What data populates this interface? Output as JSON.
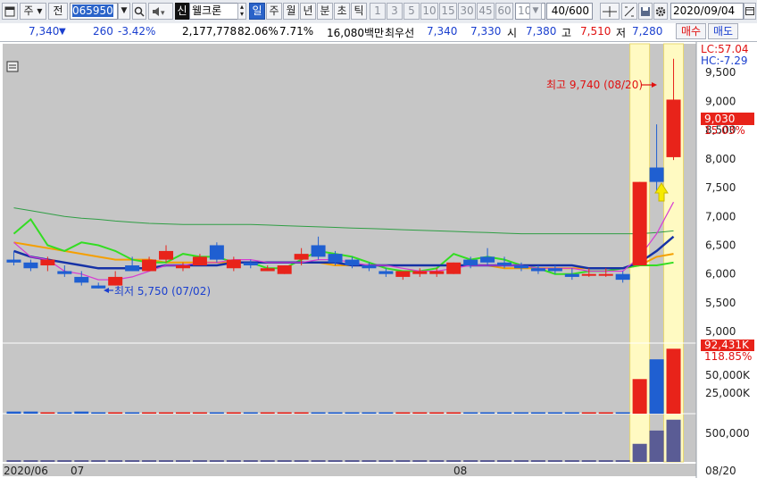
{
  "toolbar": {
    "type_label": "주",
    "prev_label": "전",
    "code": "065950",
    "new_badge": "신",
    "stock_name": "웰크론",
    "periods": [
      "일",
      "주",
      "월",
      "년",
      "분",
      "초",
      "틱"
    ],
    "intervals": [
      "1",
      "3",
      "5",
      "10",
      "15",
      "30",
      "45",
      "60"
    ],
    "interval_value": "10",
    "count": "40/600",
    "date": "2020/09/04"
  },
  "quote": {
    "price": "7,340",
    "change": "260",
    "change_pct": "-3.42%",
    "volume": "2,177,778",
    "vol_ratio": "82.06%",
    "turnover": "7.71%",
    "amount": "16,080백만",
    "best_label": "최우선",
    "ask": "7,340",
    "bid": "7,330",
    "open_label": "시",
    "open": "7,380",
    "high_label": "고",
    "high": "7,510",
    "low_label": "저",
    "low": "7,280",
    "buy_label": "매수",
    "sell_label": "매도"
  },
  "labels": {
    "lc": "LC:57.04",
    "hc": "HC:-7.29",
    "high_note": "최고 9,740 (08/20)",
    "low_note": "최저 5,750 (07/02)",
    "price_tag": "9,030",
    "price_pct": "15.03%",
    "vol_tag": "92,431K",
    "vol_pct": "118.85%",
    "vol_ticks": [
      "50,000K",
      "25,000K"
    ],
    "amt_tick": "500,000",
    "x_labels": [
      "2020/06",
      "07",
      "08"
    ],
    "x_right": "08/20"
  },
  "colors": {
    "up": "#e8231a",
    "down": "#1f5fd1",
    "highlight": "#fffac2"
  },
  "chart_data": {
    "type": "candlestick",
    "ylim": [
      4800,
      10000
    ],
    "yticks": [
      5000,
      5500,
      6000,
      6500,
      7000,
      7500,
      8000,
      8500,
      9000,
      9500
    ],
    "candles": [
      [
        6250,
        6400,
        6150,
        6200
      ],
      [
        6200,
        6250,
        6050,
        6100
      ],
      [
        6150,
        6300,
        6050,
        6250
      ],
      [
        6050,
        6150,
        5950,
        6000
      ],
      [
        5950,
        6050,
        5800,
        5850
      ],
      [
        5800,
        5850,
        5750,
        5750
      ],
      [
        5800,
        6050,
        5800,
        5950
      ],
      [
        6150,
        6300,
        6050,
        6050
      ],
      [
        6050,
        6300,
        6050,
        6250
      ],
      [
        6250,
        6500,
        6200,
        6400
      ],
      [
        6100,
        6200,
        6050,
        6150
      ],
      [
        6150,
        6350,
        6150,
        6300
      ],
      [
        6500,
        6550,
        6200,
        6250
      ],
      [
        6100,
        6300,
        6050,
        6250
      ],
      [
        6200,
        6250,
        6100,
        6150
      ],
      [
        6050,
        6150,
        6050,
        6100
      ],
      [
        6000,
        6150,
        6000,
        6150
      ],
      [
        6250,
        6450,
        6150,
        6350
      ],
      [
        6500,
        6650,
        6250,
        6300
      ],
      [
        6350,
        6400,
        6150,
        6200
      ],
      [
        6250,
        6300,
        6100,
        6150
      ],
      [
        6150,
        6200,
        6050,
        6100
      ],
      [
        6050,
        6100,
        5950,
        6000
      ],
      [
        5950,
        6050,
        5900,
        6050
      ],
      [
        6000,
        6100,
        5950,
        6050
      ],
      [
        6000,
        6100,
        5950,
        6050
      ],
      [
        6000,
        6200,
        6000,
        6200
      ],
      [
        6250,
        6300,
        6100,
        6150
      ],
      [
        6300,
        6450,
        6150,
        6200
      ],
      [
        6200,
        6300,
        6100,
        6150
      ],
      [
        6150,
        6200,
        6050,
        6100
      ],
      [
        6100,
        6150,
        6000,
        6050
      ],
      [
        6100,
        6150,
        6000,
        6050
      ],
      [
        6000,
        6100,
        5900,
        5950
      ],
      [
        6000,
        6100,
        5950,
        6000
      ],
      [
        6000,
        6100,
        5950,
        6000
      ],
      [
        6000,
        6050,
        5850,
        5900
      ],
      [
        6150,
        7600,
        6150,
        7600
      ],
      [
        7850,
        8600,
        7450,
        7600
      ],
      [
        8030,
        9740,
        7980,
        9030
      ]
    ],
    "ma5": [
      6550,
      6300,
      6250,
      6050,
      6000,
      5900,
      5900,
      5950,
      6050,
      6150,
      6150,
      6200,
      6200,
      6250,
      6250,
      6200,
      6200,
      6200,
      6250,
      6250,
      6200,
      6150,
      6150,
      6100,
      6050,
      6050,
      6100,
      6150,
      6150,
      6150,
      6150,
      6100,
      6100,
      6100,
      6050,
      6050,
      6050,
      6300,
      6700,
      7250
    ],
    "ma20": [
      6400,
      6300,
      6250,
      6200,
      6150,
      6100,
      6100,
      6100,
      6100,
      6150,
      6150,
      6150,
      6150,
      6200,
      6200,
      6200,
      6200,
      6200,
      6200,
      6200,
      6150,
      6150,
      6150,
      6150,
      6150,
      6150,
      6150,
      6150,
      6150,
      6150,
      6150,
      6150,
      6150,
      6150,
      6100,
      6100,
      6100,
      6200,
      6400,
      6650
    ],
    "ma60": [
      6550,
      6500,
      6450,
      6400,
      6350,
      6300,
      6250,
      6250,
      6250,
      6200,
      6200,
      6200,
      6200,
      6200,
      6200,
      6200,
      6200,
      6200,
      6200,
      6150,
      6150,
      6150,
      6150,
      6150,
      6150,
      6150,
      6150,
      6150,
      6150,
      6100,
      6100,
      6100,
      6100,
      6100,
      6100,
      6100,
      6100,
      6150,
      6300,
      6350
    ],
    "ma_green": [
      6700,
      6950,
      6500,
      6400,
      6550,
      6500,
      6400,
      6250,
      6200,
      6200,
      6350,
      6300,
      6300,
      6200,
      6200,
      6100,
      6100,
      6250,
      6400,
      6350,
      6300,
      6200,
      6100,
      6050,
      6050,
      6100,
      6350,
      6250,
      6300,
      6250,
      6150,
      6100,
      6000,
      6000,
      6050,
      6050,
      6100,
      6150,
      6150,
      6200
    ],
    "ma120": [
      7150,
      7100,
      7050,
      7000,
      6970,
      6950,
      6920,
      6900,
      6880,
      6870,
      6860,
      6860,
      6860,
      6860,
      6860,
      6850,
      6840,
      6830,
      6820,
      6810,
      6800,
      6790,
      6780,
      6770,
      6760,
      6750,
      6740,
      6730,
      6720,
      6710,
      6700,
      6700,
      6700,
      6700,
      6700,
      6700,
      6700,
      6700,
      6720,
      6750
    ],
    "volume_k": [
      3,
      3,
      2,
      2,
      3,
      2,
      2,
      2,
      2,
      2,
      2,
      2,
      2,
      2,
      2,
      2,
      2,
      2,
      2,
      2,
      2,
      2,
      2,
      2,
      2,
      2,
      2,
      2,
      2,
      2,
      2,
      2,
      2,
      2,
      2,
      2,
      2,
      49,
      77,
      92
    ],
    "amount": [
      20,
      20,
      15,
      15,
      20,
      15,
      15,
      15,
      15,
      15,
      15,
      15,
      15,
      15,
      15,
      15,
      15,
      15,
      15,
      15,
      15,
      15,
      15,
      15,
      15,
      15,
      15,
      15,
      15,
      15,
      15,
      15,
      15,
      15,
      15,
      15,
      15,
      300,
      520,
      700
    ]
  }
}
